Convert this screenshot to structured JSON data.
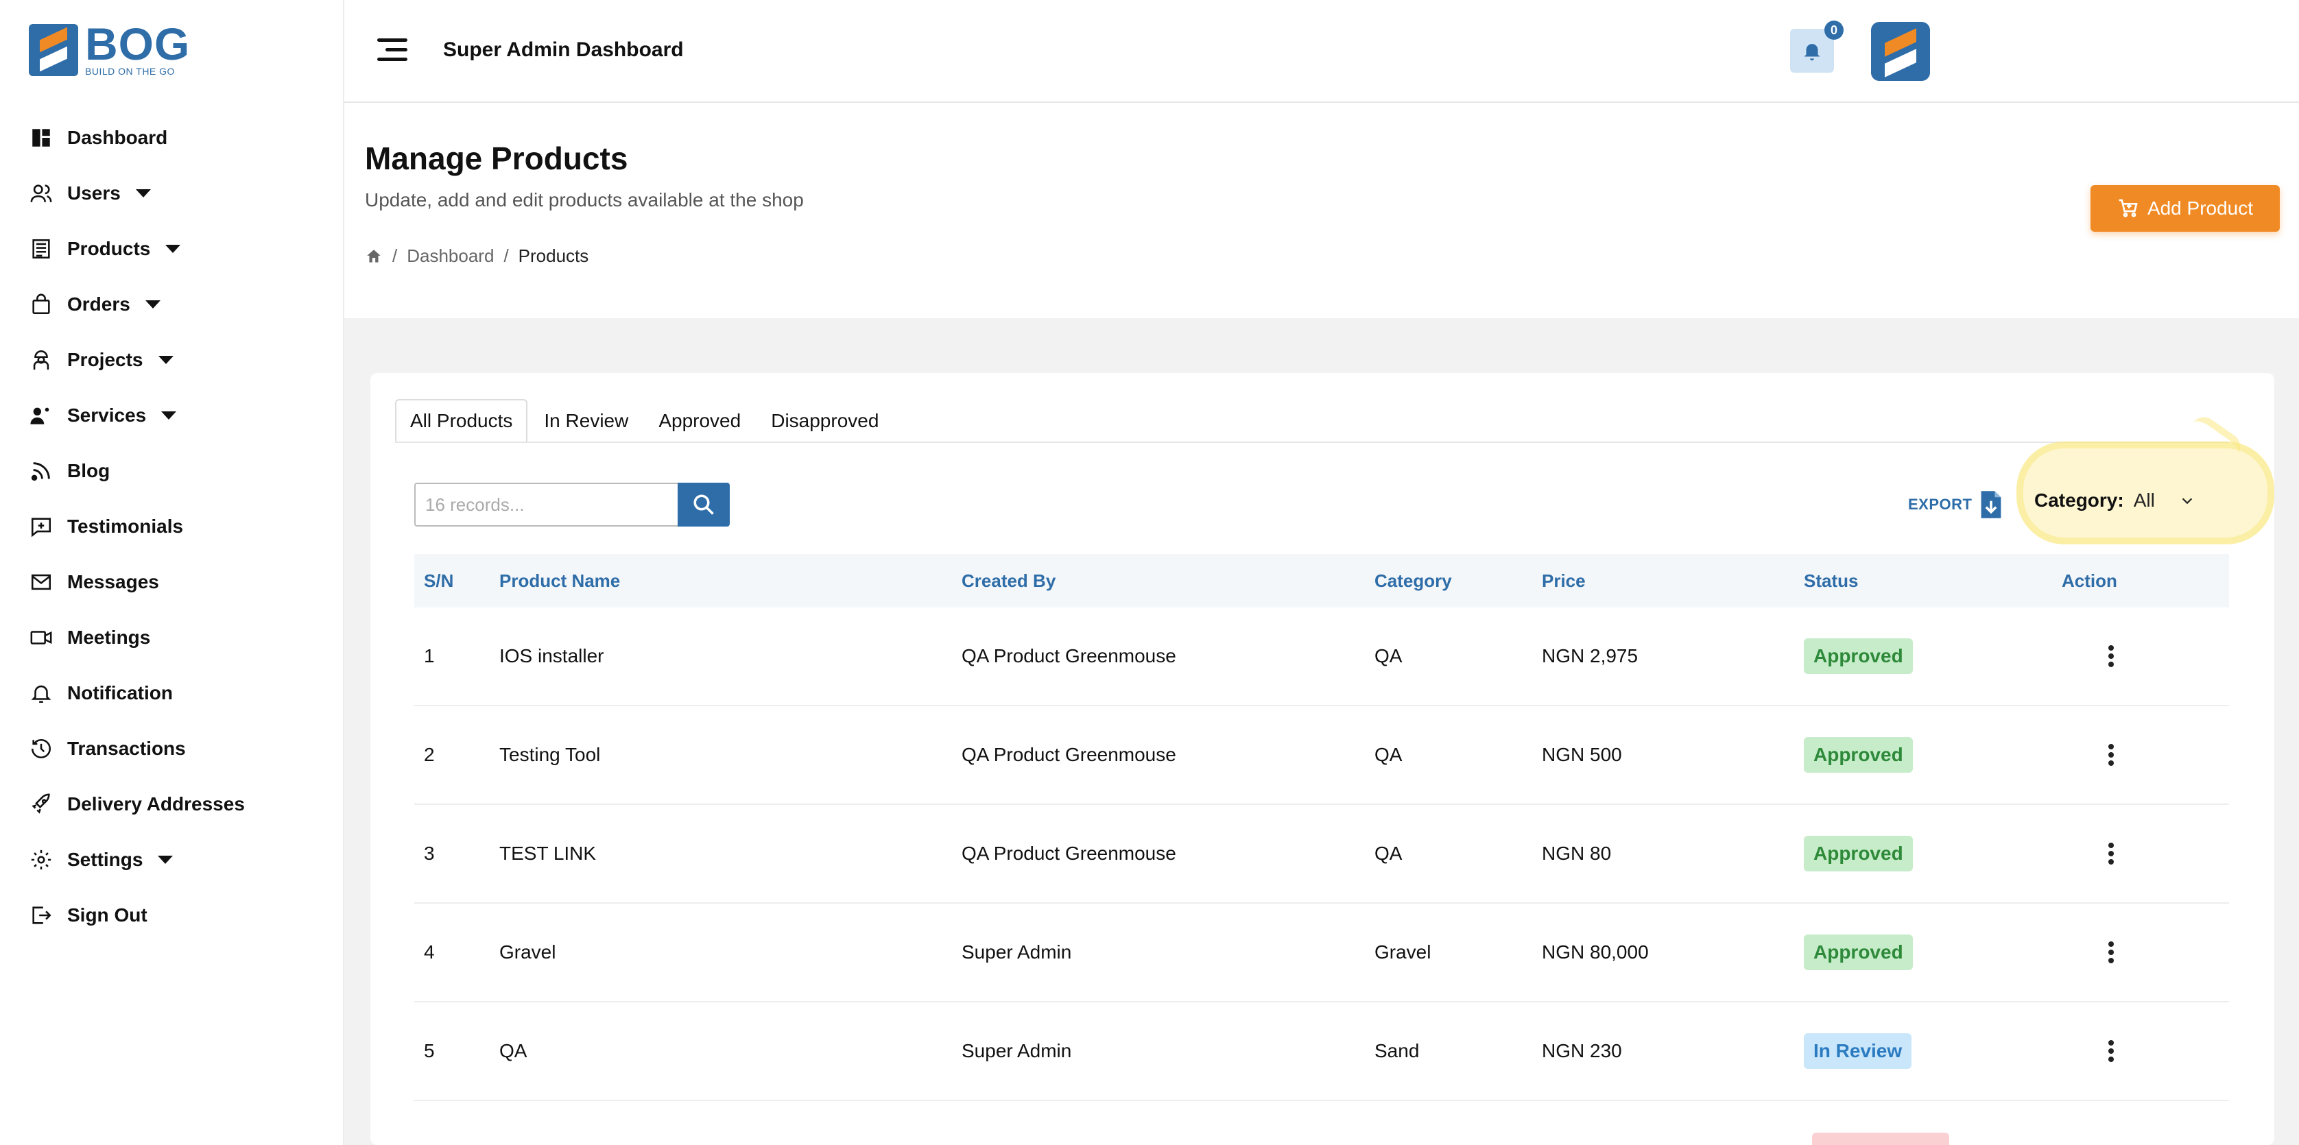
{
  "brand": {
    "name": "BOG",
    "tagline": "BUILD ON THE GO",
    "primary_color": "#2e6da8",
    "accent_color": "#f08a24"
  },
  "sidebar": {
    "items": [
      {
        "label": "Dashboard",
        "icon": "dashboard-icon",
        "has_caret": false
      },
      {
        "label": "Users",
        "icon": "users-icon",
        "has_caret": true
      },
      {
        "label": "Products",
        "icon": "products-icon",
        "has_caret": true
      },
      {
        "label": "Orders",
        "icon": "bag-icon",
        "has_caret": true
      },
      {
        "label": "Projects",
        "icon": "worker-icon",
        "has_caret": true
      },
      {
        "label": "Services",
        "icon": "services-icon",
        "has_caret": true
      },
      {
        "label": "Blog",
        "icon": "rss-icon",
        "has_caret": false
      },
      {
        "label": "Testimonials",
        "icon": "testimonial-icon",
        "has_caret": false
      },
      {
        "label": "Messages",
        "icon": "mail-icon",
        "has_caret": false
      },
      {
        "label": "Meetings",
        "icon": "video-icon",
        "has_caret": false
      },
      {
        "label": "Notification",
        "icon": "bell-icon",
        "has_caret": false
      },
      {
        "label": "Transactions",
        "icon": "history-icon",
        "has_caret": false
      },
      {
        "label": "Delivery Addresses",
        "icon": "rocket-icon",
        "has_caret": false
      },
      {
        "label": "Settings",
        "icon": "gear-icon",
        "has_caret": true
      },
      {
        "label": "Sign Out",
        "icon": "sign-out-icon",
        "has_caret": false
      }
    ]
  },
  "header": {
    "title": "Super Admin Dashboard",
    "notification_count": "0"
  },
  "page": {
    "title": "Manage Products",
    "subtitle": "Update, add and edit products available at the shop",
    "breadcrumb": {
      "sep1": "/",
      "item1": "Dashboard",
      "sep2": "/",
      "item2": "Products"
    },
    "add_button": "Add Product"
  },
  "tabs": [
    "All Products",
    "In Review",
    "Approved",
    "Disapproved"
  ],
  "active_tab": "All Products",
  "search": {
    "placeholder": "16 records..."
  },
  "export_label": "EXPORT",
  "category_filter": {
    "label": "Category:",
    "value": "All"
  },
  "table": {
    "headers": [
      "S/N",
      "Product Name",
      "Created By",
      "Category",
      "Price",
      "Status",
      "Action"
    ],
    "rows": [
      {
        "sn": "1",
        "name": "IOS installer",
        "created_by": "QA Product Greenmouse",
        "category": "QA",
        "price": "NGN 2,975",
        "status": "Approved"
      },
      {
        "sn": "2",
        "name": "Testing Tool",
        "created_by": "QA Product Greenmouse",
        "category": "QA",
        "price": "NGN 500",
        "status": "Approved"
      },
      {
        "sn": "3",
        "name": "TEST LINK",
        "created_by": "QA Product Greenmouse",
        "category": "QA",
        "price": "NGN 80",
        "status": "Approved"
      },
      {
        "sn": "4",
        "name": "Gravel",
        "created_by": "Super Admin",
        "category": "Gravel",
        "price": "NGN 80,000",
        "status": "Approved"
      },
      {
        "sn": "5",
        "name": "QA",
        "created_by": "Super Admin",
        "category": "Sand",
        "price": "NGN 230",
        "status": "In Review"
      }
    ]
  }
}
